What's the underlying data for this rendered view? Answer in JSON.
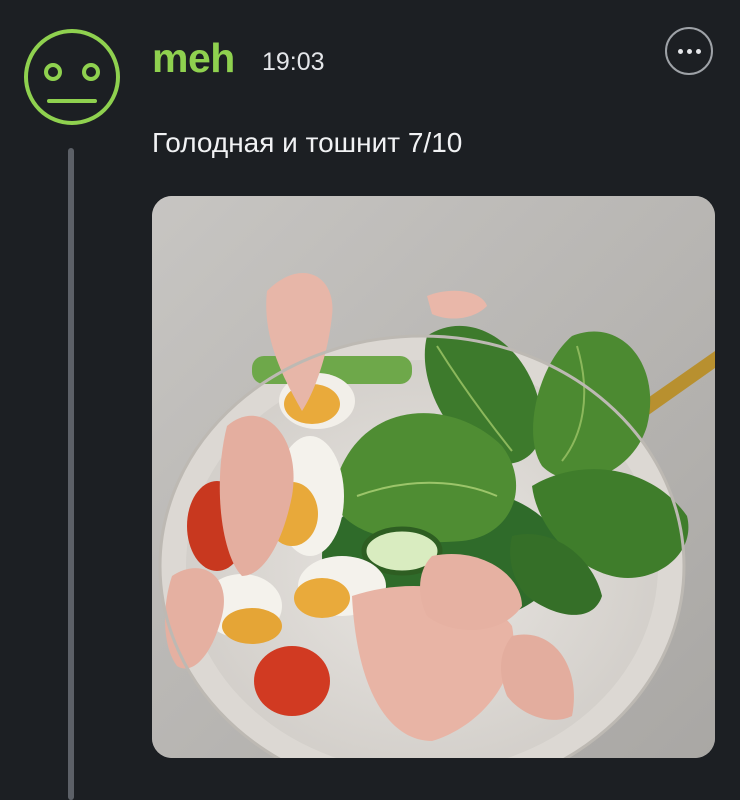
{
  "post": {
    "username": "meh",
    "time": "19:03",
    "text": "Голодная и тошнит 7/10",
    "avatar_icon": "neutral-face-icon",
    "more_icon": "more-options-icon",
    "accent_color": "#8fd14f",
    "photo_subject": "salad-bowl-photo"
  }
}
